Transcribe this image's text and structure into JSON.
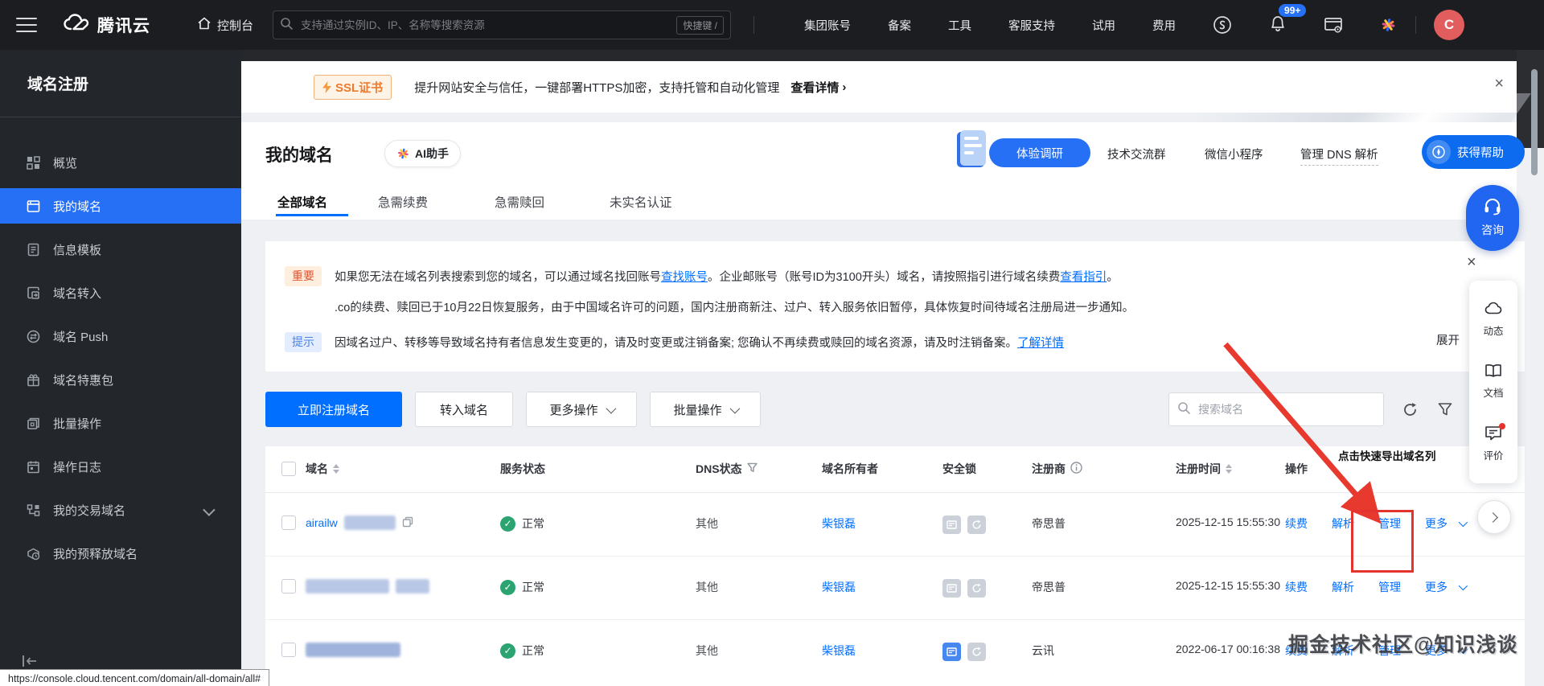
{
  "topbar": {
    "logo_text": "腾讯云",
    "console_label": "控制台",
    "search_placeholder": "支持通过实例ID、IP、名称等搜索资源",
    "shortcut_hint": "快捷键 /",
    "menu": [
      "集团账号",
      "备案",
      "工具",
      "客服支持",
      "试用",
      "费用"
    ],
    "notification_count": "99+",
    "avatar_initial": "C"
  },
  "sidebar": {
    "title": "域名注册",
    "items": [
      {
        "label": "概览",
        "selected": false
      },
      {
        "label": "我的域名",
        "selected": true
      },
      {
        "label": "信息模板",
        "selected": false
      },
      {
        "label": "域名转入",
        "selected": false
      },
      {
        "label": "域名 Push",
        "selected": false
      },
      {
        "label": "域名特惠包",
        "selected": false
      },
      {
        "label": "批量操作",
        "selected": false
      },
      {
        "label": "操作日志",
        "selected": false
      },
      {
        "label": "我的交易域名",
        "selected": false,
        "expandable": true
      },
      {
        "label": "我的预释放域名",
        "selected": false
      }
    ]
  },
  "ssl_banner": {
    "badge": "SSL证书",
    "text": "提升网站安全与信任，一键部署HTTPS加密，支持托管和自动化管理",
    "link": "查看详情"
  },
  "page_header": {
    "title": "我的域名",
    "ai_badge": "AI助手",
    "links": {
      "survey": "体验调研",
      "tech_group": "技术交流群",
      "mini_program": "微信小程序",
      "dns": "管理 DNS 解析",
      "help": "获得帮助"
    }
  },
  "tabs": [
    {
      "label": "全部域名",
      "active": true
    },
    {
      "label": "急需续费",
      "active": false
    },
    {
      "label": "急需赎回",
      "active": false
    },
    {
      "label": "未实名认证",
      "active": false
    }
  ],
  "notice": {
    "line1_badge": "重要",
    "line1_pre": "如果您无法在域名列表搜索到您的域名，可以通过域名找回账号 ",
    "line1_link1": "查找账号",
    "line1_mid": "。企业邮账号（账号ID为3100开头）域名，请按照指引进行域名续费 ",
    "line1_link2": "查看指引",
    "line1_end": "。",
    "line2": ".co的续费、赎回已于10月22日恢复服务，由于中国域名许可的问题，国内注册商新注、过户、转入服务依旧暂停，具体恢复时间待域名注册局进一步通知。",
    "line3_badge": "提示",
    "line3_text": "因域名过户、转移等导致域名持有者信息发生变更的，请及时变更或注销备案; 您确认不再续费或赎回的域名资源，请及时注销备案。",
    "line3_link": "了解详情",
    "expand": "展开"
  },
  "toolbar": {
    "register": "立即注册域名",
    "transfer": "转入域名",
    "more": "更多操作",
    "batch": "批量操作",
    "search_placeholder": "搜索域名"
  },
  "table": {
    "columns": [
      "域名",
      "服务状态",
      "DNS状态",
      "域名所有者",
      "安全锁",
      "注册商",
      "注册时间",
      "操作"
    ],
    "action_labels": [
      "续费",
      "解析",
      "管理",
      "更多"
    ],
    "rows": [
      {
        "domain_visible": "airailw",
        "status": "正常",
        "dns": "其他",
        "owner": "柴银磊",
        "registrar": "帝思普",
        "registered_at": "2025-12-15 15:55:30"
      },
      {
        "domain_visible": "",
        "status": "正常",
        "dns": "其他",
        "owner": "柴银磊",
        "registrar": "帝思普",
        "registered_at": "2025-12-15 15:55:30"
      },
      {
        "domain_visible": "",
        "status": "正常",
        "dns": "其他",
        "owner": "柴银磊",
        "registrar": "云讯",
        "registered_at": "2022-06-17 00:16:38"
      }
    ]
  },
  "floating": {
    "consult": "咨询",
    "feed": "动态",
    "docs": "文档",
    "feedback": "评价"
  },
  "tooltip_export": "点击快速导出域名列",
  "watermark": "掘金技术社区@知识浅谈",
  "status_bar_url": "https://console.cloud.tencent.com/domain/all-domain/all#",
  "colors": {
    "accent": "#006eff",
    "green": "#2ba471",
    "red": "#e5342e",
    "warn_text": "#e5502e",
    "warn_bg": "#fdeede",
    "tip_text": "#4c82e8",
    "tip_bg": "#e3edff",
    "avatar": "#e25d5d"
  }
}
